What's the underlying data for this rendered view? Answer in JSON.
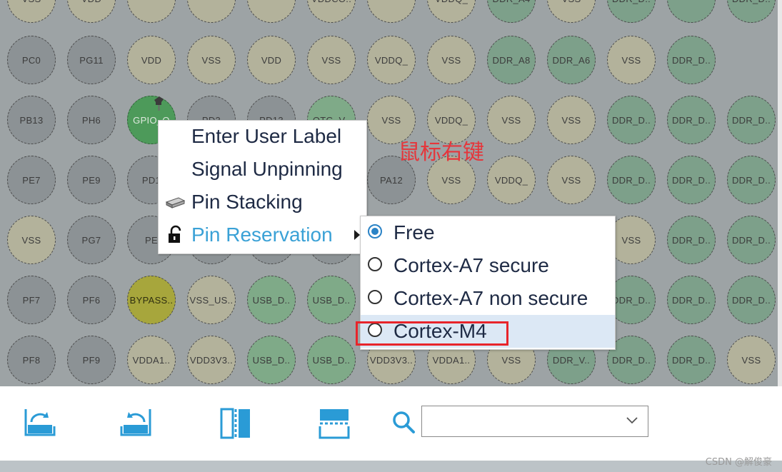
{
  "pins": [
    [
      {
        "label": "VSS",
        "tone": "tan"
      },
      {
        "label": "VDD",
        "tone": "tan"
      },
      {
        "label": "",
        "tone": "tan"
      },
      {
        "label": "",
        "tone": "tan"
      },
      {
        "label": "",
        "tone": "tan"
      },
      {
        "label": "VDDCO..",
        "tone": "tan"
      },
      {
        "label": "",
        "tone": "tan"
      },
      {
        "label": "VDDQ_",
        "tone": "tan"
      },
      {
        "label": "DDR_A4",
        "tone": "ddr"
      },
      {
        "label": "VSS",
        "tone": "tan"
      },
      {
        "label": "DDR_D..",
        "tone": "ddr"
      },
      {
        "label": "",
        "tone": "ddr"
      },
      {
        "label": "DDR_D..",
        "tone": "ddr"
      }
    ],
    [
      {
        "label": "PC0",
        "tone": "gray"
      },
      {
        "label": "PG11",
        "tone": "gray"
      },
      {
        "label": "VDD",
        "tone": "tan"
      },
      {
        "label": "VSS",
        "tone": "tan"
      },
      {
        "label": "VDD",
        "tone": "tan"
      },
      {
        "label": "VSS",
        "tone": "tan"
      },
      {
        "label": "VDDQ_",
        "tone": "tan"
      },
      {
        "label": "VSS",
        "tone": "tan"
      },
      {
        "label": "DDR_A8",
        "tone": "ddr"
      },
      {
        "label": "DDR_A6",
        "tone": "ddr"
      },
      {
        "label": "VSS",
        "tone": "tan"
      },
      {
        "label": "DDR_D..",
        "tone": "ddr"
      }
    ],
    [
      {
        "label": "PB13",
        "tone": "gray"
      },
      {
        "label": "PH6",
        "tone": "gray"
      },
      {
        "label": "GPIO_O",
        "tone": "gpio"
      },
      {
        "label": "PD3",
        "tone": "gray"
      },
      {
        "label": "PD13",
        "tone": "gray"
      },
      {
        "label": "OTG_V..",
        "tone": "green"
      },
      {
        "label": "VSS",
        "tone": "tan"
      },
      {
        "label": "VDDQ_",
        "tone": "tan"
      },
      {
        "label": "VSS",
        "tone": "tan"
      },
      {
        "label": "VSS",
        "tone": "tan"
      },
      {
        "label": "DDR_D..",
        "tone": "ddr"
      },
      {
        "label": "DDR_D..",
        "tone": "ddr"
      },
      {
        "label": "DDR_D..",
        "tone": "ddr"
      }
    ],
    [
      {
        "label": "PE7",
        "tone": "gray"
      },
      {
        "label": "PE9",
        "tone": "gray"
      },
      {
        "label": "PD1",
        "tone": "gray"
      },
      {
        "label": "",
        "tone": "gray"
      },
      {
        "label": "",
        "tone": "gray"
      },
      {
        "label": "",
        "tone": "gray"
      },
      {
        "label": "PA12",
        "tone": "gray"
      },
      {
        "label": "VSS",
        "tone": "tan"
      },
      {
        "label": "VDDQ_",
        "tone": "tan"
      },
      {
        "label": "VSS",
        "tone": "tan"
      },
      {
        "label": "DDR_D..",
        "tone": "ddr"
      },
      {
        "label": "DDR_D..",
        "tone": "ddr"
      },
      {
        "label": "DDR_D..",
        "tone": "ddr"
      }
    ],
    [
      {
        "label": "VSS",
        "tone": "tan"
      },
      {
        "label": "PG7",
        "tone": "gray"
      },
      {
        "label": "PE",
        "tone": "gray"
      },
      {
        "label": "",
        "tone": "gray"
      },
      {
        "label": "",
        "tone": "gray"
      },
      {
        "label": "",
        "tone": "gray"
      },
      {
        "label": "",
        "tone": "gray"
      },
      {
        "label": "",
        "tone": "gray"
      },
      {
        "label": "",
        "tone": "gray"
      },
      {
        "label": "",
        "tone": "gray"
      },
      {
        "label": "VSS",
        "tone": "tan"
      },
      {
        "label": "DDR_D..",
        "tone": "ddr"
      },
      {
        "label": "DDR_D..",
        "tone": "ddr"
      }
    ],
    [
      {
        "label": "PF7",
        "tone": "gray"
      },
      {
        "label": "PF6",
        "tone": "gray"
      },
      {
        "label": "BYPASS..",
        "tone": "olive"
      },
      {
        "label": "VSS_US..",
        "tone": "tan"
      },
      {
        "label": "USB_D..",
        "tone": "green"
      },
      {
        "label": "USB_D..",
        "tone": "green"
      },
      {
        "label": "",
        "tone": "gray"
      },
      {
        "label": "",
        "tone": "gray"
      },
      {
        "label": "",
        "tone": "gray"
      },
      {
        "label": "",
        "tone": "gray"
      },
      {
        "label": "DDR_D..",
        "tone": "ddr"
      },
      {
        "label": "DDR_D..",
        "tone": "ddr"
      },
      {
        "label": "DDR_D..",
        "tone": "ddr"
      }
    ],
    [
      {
        "label": "PF8",
        "tone": "gray"
      },
      {
        "label": "PF9",
        "tone": "gray"
      },
      {
        "label": "VDDA1..",
        "tone": "tan"
      },
      {
        "label": "VDD3V3..",
        "tone": "tan"
      },
      {
        "label": "USB_D..",
        "tone": "green"
      },
      {
        "label": "USB_D..",
        "tone": "green"
      },
      {
        "label": "VDD3V3..",
        "tone": "tan"
      },
      {
        "label": "VDDA1..",
        "tone": "tan"
      },
      {
        "label": "VSS",
        "tone": "tan"
      },
      {
        "label": "DDR_V..",
        "tone": "ddr"
      },
      {
        "label": "DDR_D..",
        "tone": "ddr"
      },
      {
        "label": "DDR_D..",
        "tone": "ddr"
      },
      {
        "label": "VSS",
        "tone": "tan"
      }
    ]
  ],
  "context_menu": {
    "items": [
      {
        "label": "Enter User Label",
        "icon": ""
      },
      {
        "label": "Signal Unpinning",
        "icon": ""
      },
      {
        "label": "Pin Stacking",
        "icon": "stack-icon"
      },
      {
        "label": "Pin Reservation",
        "icon": "unlock-icon"
      }
    ]
  },
  "submenu": {
    "options": [
      {
        "label": "Free",
        "checked": true
      },
      {
        "label": "Cortex-A7 secure",
        "checked": false
      },
      {
        "label": "Cortex-A7 non secure",
        "checked": false
      },
      {
        "label": "Cortex-M4",
        "checked": false
      }
    ]
  },
  "annotation_text": "鼠标右键",
  "toolbar": {
    "icons": [
      "export-icon",
      "import-icon",
      "split-view-icon",
      "horizontal-split-icon"
    ],
    "search_value": ""
  },
  "watermark": "CSDN @解俊豪",
  "colors": {
    "accent": "#3aa1d6",
    "highlight": "#e8242a",
    "gpio": "#4d9a5a"
  }
}
